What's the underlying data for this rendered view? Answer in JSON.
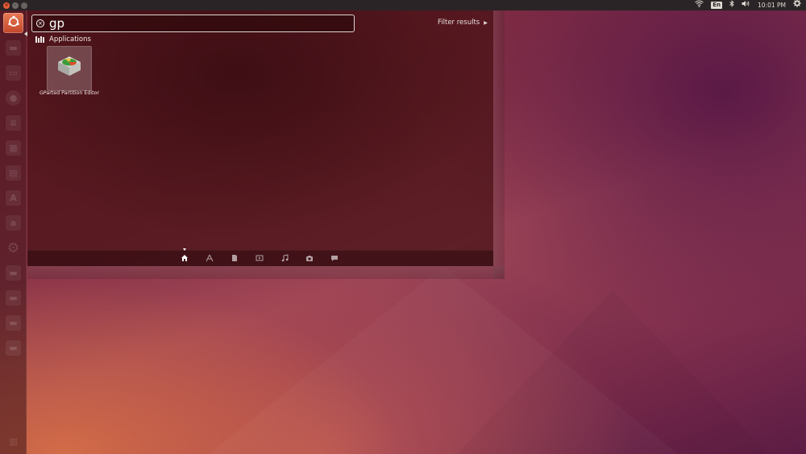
{
  "top_panel": {
    "window_buttons": [
      "×",
      "–",
      "▢"
    ],
    "indicators": {
      "network_icon": "wifi-icon",
      "keyboard_label": "En",
      "bluetooth_icon": "bluetooth-icon",
      "volume_icon": "volume-icon",
      "clock": "10:01 PM",
      "session_icon": "gear-icon"
    }
  },
  "launcher": {
    "items": [
      {
        "name": "dash-home",
        "icon": "ubuntu-logo-icon",
        "active": true
      },
      {
        "name": "files",
        "icon": "drive-icon"
      },
      {
        "name": "file-manager",
        "icon": "folder-icon"
      },
      {
        "name": "firefox",
        "icon": "firefox-icon"
      },
      {
        "name": "writer",
        "icon": "document-icon"
      },
      {
        "name": "calc",
        "icon": "spreadsheet-icon"
      },
      {
        "name": "impress",
        "icon": "presentation-icon"
      },
      {
        "name": "software-center",
        "icon": "software-center-icon"
      },
      {
        "name": "amazon",
        "icon": "amazon-icon"
      },
      {
        "name": "settings",
        "icon": "gear-icon"
      },
      {
        "name": "workspace-1",
        "icon": "drive-icon"
      },
      {
        "name": "workspace-2",
        "icon": "drive-icon"
      },
      {
        "name": "workspace-3",
        "icon": "drive-icon"
      },
      {
        "name": "workspace-4",
        "icon": "drive-icon"
      },
      {
        "name": "trash",
        "icon": "trash-icon"
      }
    ]
  },
  "dash": {
    "search": {
      "value": "gp",
      "clear_icon": "close-circle-icon"
    },
    "filter_label": "Filter results",
    "category_label": "Applications",
    "results": [
      {
        "label": "GParted Partition Editor",
        "icon": "gparted-icon"
      }
    ],
    "lenses": [
      "home-icon",
      "applications-icon",
      "files-icon",
      "video-icon",
      "music-icon",
      "photo-icon",
      "social-icon"
    ],
    "active_lens": "home-icon"
  },
  "colors": {
    "accent": "#dd4814",
    "panel": "#2b2426"
  }
}
